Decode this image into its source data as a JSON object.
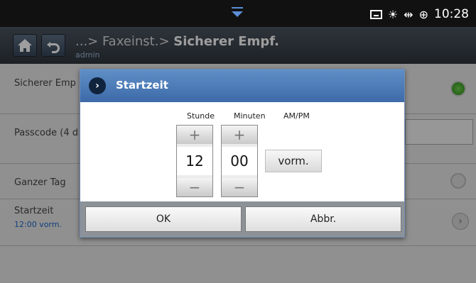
{
  "statusbar": {
    "time": "10:28",
    "icons": [
      "tray-icon",
      "brightness-icon",
      "usb-icon",
      "globe-icon"
    ]
  },
  "header": {
    "breadcrumb_prefix": "...> Faxeinst.> ",
    "breadcrumb_current": "Sicherer Empf.",
    "user": "admin"
  },
  "list": {
    "items": [
      {
        "label": "Sicherer Emp",
        "control": "radio-on"
      },
      {
        "label": "Passcode (4 d",
        "control": "text-field"
      },
      {
        "label": "Ganzer Tag",
        "control": "radio-off"
      },
      {
        "label": "Startzeit",
        "value": "12:00 vorm.",
        "control": "chevron"
      }
    ]
  },
  "dialog": {
    "title": "Startzeit",
    "columns": {
      "hour": "Stunde",
      "minute": "Minuten",
      "ampm": "AM/PM"
    },
    "hour_value": "12",
    "minute_value": "00",
    "plus": "+",
    "minus": "−",
    "ampm_value": "vorm.",
    "ok_label": "OK",
    "cancel_label": "Abbr."
  },
  "colors": {
    "accent": "#4a78b5",
    "radio_on": "#3fa82a"
  }
}
